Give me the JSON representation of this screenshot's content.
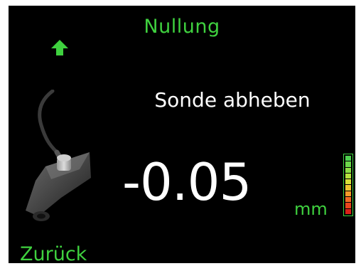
{
  "screen": {
    "title": "Nullung",
    "instruction": "Sonde abheben",
    "value": "-0.05",
    "unit": "mm",
    "back_label": "Zurück",
    "up_icon": "arrow-up-icon",
    "probe_icon": "probe-sensor-icon"
  },
  "colors": {
    "accent": "#3fd13f",
    "background": "#000000",
    "text": "#ffffff"
  },
  "level_indicator": {
    "segments": [
      "#4fd04f",
      "#6cd84a",
      "#8ede44",
      "#b6e23e",
      "#d8df37",
      "#efc42f",
      "#f59a28",
      "#f06a22",
      "#e8451c",
      "#d91f17"
    ],
    "level_fraction": 1.0
  }
}
